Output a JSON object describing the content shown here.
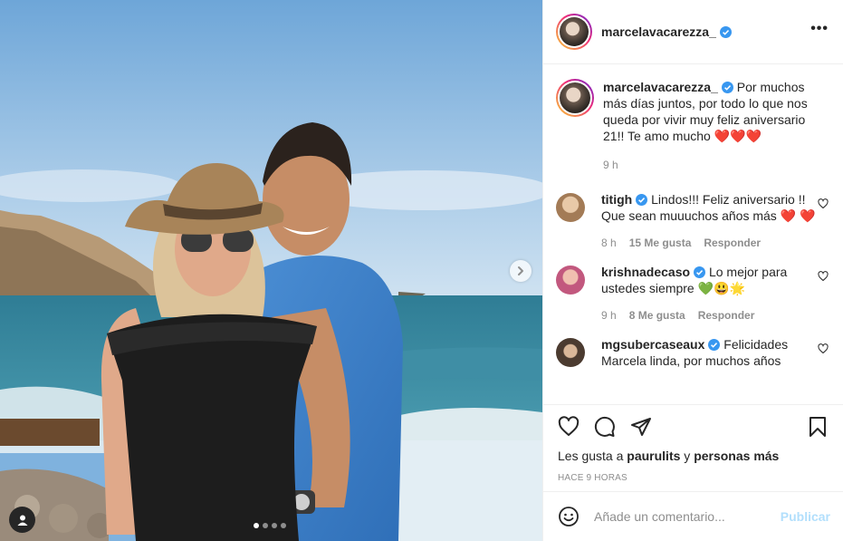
{
  "post": {
    "username": "marcelavacarezza_",
    "more_icon": "more-horizontal-icon",
    "caption": {
      "username": "marcelavacarezza_",
      "text": "Por muchos más días juntos, por todo lo que nos queda por vivir muy feliz aniversario 21!! Te amo mucho ❤️❤️❤️",
      "time": "9 h"
    },
    "comments": [
      {
        "username": "titigh",
        "verified": true,
        "text": "Lindos!!! Feliz aniversario !! Que sean muuuchos años más ❤️ ❤️",
        "time": "8 h",
        "likes": "15 Me gusta",
        "reply": "Responder",
        "avatar_color": "#c9a27e"
      },
      {
        "username": "krishnadecaso",
        "verified": true,
        "text": "Lo mejor para ustedes siempre 💚😃🌟",
        "time": "9 h",
        "likes": "8 Me gusta",
        "reply": "Responder",
        "avatar_color": "#d9a7b8"
      },
      {
        "username": "mgsubercaseaux",
        "verified": true,
        "text": "Felicidades Marcela linda, por muchos años",
        "avatar_color": "#6d5b4c"
      }
    ],
    "liked_by": {
      "prefix": "Les gusta a",
      "user": "paurulits",
      "joiner": "y",
      "others": "personas más"
    },
    "timestamp": "HACE 9 HORAS",
    "comment_input": {
      "placeholder": "Añade un comentario...",
      "value": ""
    },
    "publish_label": "Publicar",
    "carousel": {
      "total": 4,
      "active": 0
    }
  },
  "colors": {
    "verified_blue": "#3897f0",
    "publish_disabled": "#b2dffc",
    "muted_text": "#8e8e8e",
    "heart_red": "#ed4956"
  },
  "icons": [
    "heart-icon",
    "comment-icon",
    "share-icon",
    "bookmark-icon",
    "emoji-icon",
    "chevron-right-icon",
    "user-tag-icon"
  ]
}
